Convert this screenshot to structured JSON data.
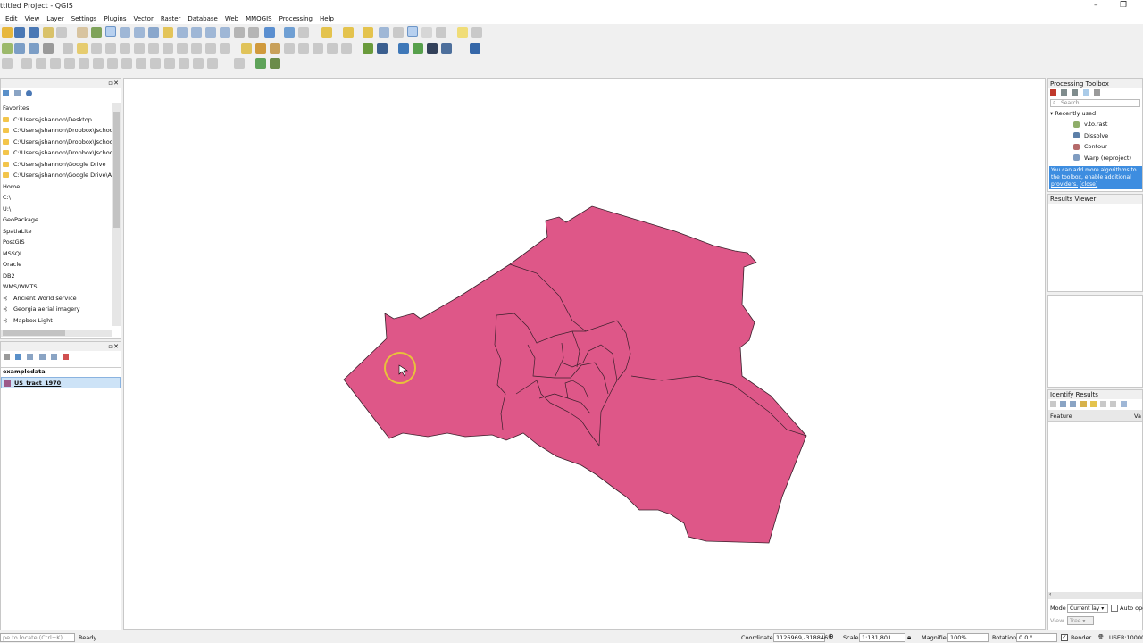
{
  "window": {
    "title": "ttitled Project - QGIS",
    "min": "–",
    "max": "❐"
  },
  "menu": [
    "Edit",
    "View",
    "Layer",
    "Settings",
    "Plugins",
    "Vector",
    "Raster",
    "Database",
    "Web",
    "MMQGIS",
    "Processing",
    "Help"
  ],
  "browser": {
    "items": [
      {
        "label": "Favorites",
        "kind": "header"
      },
      {
        "label": "C:\\Users\\jshannon\\Desktop",
        "kind": "folder"
      },
      {
        "label": "C:\\Users\\jshannon\\Dropbox\\Jschool",
        "kind": "folder"
      },
      {
        "label": "C:\\Users\\jshannon\\Dropbox\\Jschool\\",
        "kind": "folder"
      },
      {
        "label": "C:\\Users\\jshannon\\Dropbox\\Jschool\\",
        "kind": "folder"
      },
      {
        "label": "C:\\Users\\jshannon\\Google Drive",
        "kind": "folder"
      },
      {
        "label": "C:\\Users\\jshannon\\Google Drive\\Aca",
        "kind": "folder"
      },
      {
        "label": "Home",
        "kind": "plain"
      },
      {
        "label": "C:\\",
        "kind": "plain"
      },
      {
        "label": "U:\\",
        "kind": "plain"
      },
      {
        "label": "GeoPackage",
        "kind": "plain"
      },
      {
        "label": "SpatiaLite",
        "kind": "plain"
      },
      {
        "label": "PostGIS",
        "kind": "plain"
      },
      {
        "label": "MSSQL",
        "kind": "plain"
      },
      {
        "label": "Oracle",
        "kind": "plain"
      },
      {
        "label": "DB2",
        "kind": "plain"
      },
      {
        "label": "WMS/WMTS",
        "kind": "plain"
      },
      {
        "label": "Ancient World service",
        "kind": "wms"
      },
      {
        "label": "Georgia aerial imagery",
        "kind": "wms"
      },
      {
        "label": "Mapbox Light",
        "kind": "wms"
      }
    ]
  },
  "layers": {
    "group": "exampledata",
    "layer": "US_tract_1970",
    "layer_color": "#9d5a8a"
  },
  "map": {
    "fill": "#de5788",
    "stroke": "#3a1f2b"
  },
  "processing": {
    "title": "Processing Toolbox",
    "search_placeholder": "Search...",
    "recent_label": "Recently used",
    "algorithms": [
      "v.to.rast",
      "Dissolve",
      "Contour",
      "Warp (reproject)"
    ],
    "notice_prefix": "You can add more algorithms to the toolbox,",
    "notice_link": "enable additional providers.",
    "notice_close": "[close]"
  },
  "results_viewer": {
    "title": "Results Viewer"
  },
  "identify": {
    "title": "Identify Results",
    "col_feature": "Feature",
    "col_value": "Va",
    "mode_label": "Mode",
    "mode_value": "Current lay",
    "auto_label": "Auto ope",
    "view_label": "View",
    "view_value": "Tree"
  },
  "status": {
    "locate_placeholder": "pe to locate (Ctrl+K)",
    "ready": "Ready",
    "coord_label": "Coordinate",
    "coord_value": "1126969,-318846",
    "scale_label": "Scale",
    "scale_value": "1:131,801",
    "magnifier_label": "Magnifier",
    "magnifier_value": "100%",
    "rotation_label": "Rotation",
    "rotation_value": "0.0 °",
    "render_label": "Render",
    "crs": "USER:10000"
  }
}
